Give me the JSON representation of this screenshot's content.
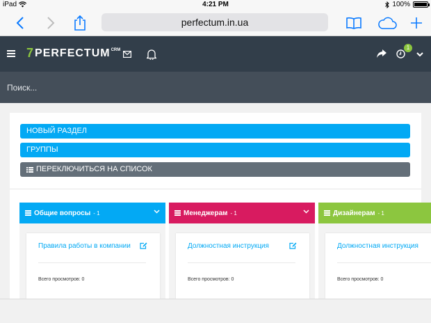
{
  "status_bar": {
    "device": "iPad",
    "time": "4:21 PM",
    "battery": "100%",
    "battery_level": 1.0
  },
  "browser": {
    "url": "perfectum.in.ua",
    "icons": [
      "back-icon",
      "forward-icon",
      "share-icon",
      "bookmarks-icon",
      "cloud-icon",
      "new-tab-icon"
    ]
  },
  "header": {
    "logo_text": "PERFECTUM",
    "logo_sup": "CRM",
    "notification_count": "1",
    "icons": [
      "menu-icon",
      "mail-icon",
      "bell-icon",
      "share-arrow-icon",
      "timer-icon",
      "chevron-down-icon"
    ]
  },
  "search": {
    "placeholder": "Поиск...",
    "value": ""
  },
  "actions": {
    "new_section": "НОВЫЙ РАЗДЕЛ",
    "groups": "ГРУППЫ",
    "switch_to_list": "ПЕРЕКЛЮЧИТЬСЯ НА СПИСОК"
  },
  "colors": {
    "header_bg": "#323e4a",
    "search_bg": "#444e59",
    "accent_blue": "#03a9f4",
    "accent_pink": "#d81b60",
    "accent_green": "#8cc63f",
    "grey_button": "#646f79"
  },
  "columns": [
    {
      "title": "Общие вопросы",
      "count": "- 1",
      "color": "#03a9f4",
      "card": {
        "title": "Правила работы в компании",
        "views": "Всего просмотров: 0"
      }
    },
    {
      "title": "Менеджерам",
      "count": "- 1",
      "color": "#d81b60",
      "card": {
        "title": "Должностная инструкция",
        "views": "Всего просмотров: 0"
      }
    },
    {
      "title": "Дизайнерам",
      "count": "- 1",
      "color": "#8cc63f",
      "card": {
        "title": "Должностная инструкция",
        "views": "Всего просмотров: 0"
      }
    }
  ]
}
